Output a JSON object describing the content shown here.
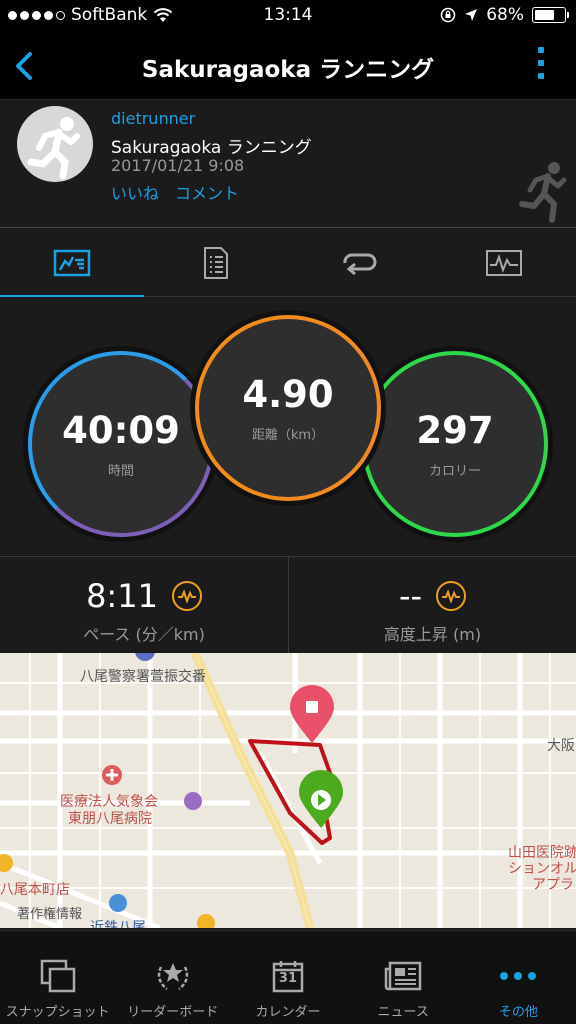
{
  "status": {
    "carrier": "SoftBank",
    "time": "13:14",
    "battery": "68%",
    "battery_level": 0.68
  },
  "nav": {
    "title": "Sakuragaoka ランニング"
  },
  "activity": {
    "user": "dietrunner",
    "name": "Sakuragaoka ランニング",
    "date": "2017/01/21 9:08",
    "like": "いいね",
    "comment": "コメント"
  },
  "stats": {
    "time": {
      "value": "40:09",
      "label": "時間"
    },
    "distance": {
      "value": "4.90",
      "label": "距離（km）"
    },
    "calories": {
      "value": "297",
      "label": "カロリー"
    }
  },
  "metrics": {
    "pace": {
      "value": "8:11",
      "label": "ペース (分／km)"
    },
    "elevation": {
      "value": "--",
      "label": "高度上昇 (m)"
    }
  },
  "map": {
    "labels": {
      "police": "八尾警察署萱振交番",
      "hospital1": "医療法人気象会",
      "hospital2": "東朋八尾病院",
      "osaka": "大阪",
      "yamada1": "山田医院跡",
      "yamada2": "ションオル",
      "yamada3": "アプラ",
      "honmachi": "八尾本町店",
      "copyright": "著作権情報",
      "kintetsu": "近鉄八尾"
    }
  },
  "bottom": {
    "items": [
      {
        "label": "スナップショット",
        "icon": "snapshot-icon"
      },
      {
        "label": "リーダーボード",
        "icon": "leaderboard-icon"
      },
      {
        "label": "カレンダー",
        "icon": "calendar-icon",
        "day": "31"
      },
      {
        "label": "ニュース",
        "icon": "news-icon"
      },
      {
        "label": "その他",
        "icon": "more-icon"
      }
    ]
  },
  "colors": {
    "accent": "#1ba1e2",
    "time_ring": "#7d5fb9",
    "distance_ring": "#f08c1e",
    "calorie_ring": "#2fd84a",
    "route": "#c0101a"
  }
}
